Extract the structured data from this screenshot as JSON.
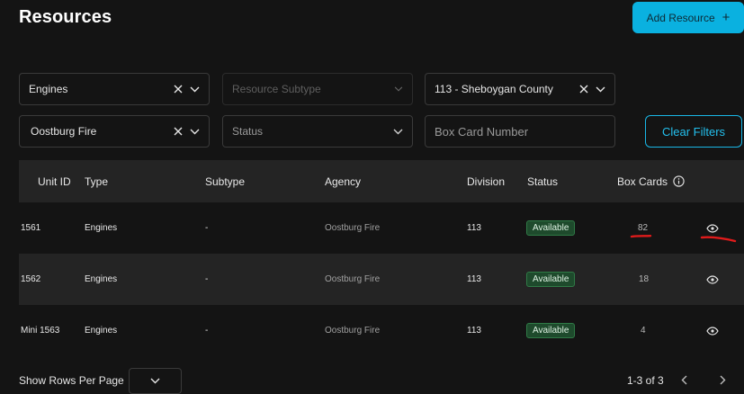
{
  "header": {
    "title": "Resources",
    "add_button_label": "Add Resource"
  },
  "filters": {
    "type": {
      "value": "Engines"
    },
    "subtype": {
      "placeholder": "Resource Subtype"
    },
    "division": {
      "value": "113 - Sheboygan County"
    },
    "agency": {
      "value": "Oostburg Fire"
    },
    "status": {
      "placeholder": "Status"
    },
    "box_card": {
      "placeholder": "Box Card Number"
    },
    "clear_label": "Clear Filters"
  },
  "table": {
    "headers": {
      "unit_id": "Unit ID",
      "type": "Type",
      "subtype": "Subtype",
      "agency": "Agency",
      "division": "Division",
      "status": "Status",
      "box_cards": "Box Cards"
    },
    "rows": [
      {
        "unit_id": "1561",
        "type": "Engines",
        "subtype": "-",
        "agency": "Oostburg Fire",
        "division": "113",
        "status": "Available",
        "box_cards": "82"
      },
      {
        "unit_id": "1562",
        "type": "Engines",
        "subtype": "-",
        "agency": "Oostburg Fire",
        "division": "113",
        "status": "Available",
        "box_cards": "18"
      },
      {
        "unit_id": "Mini 1563",
        "type": "Engines",
        "subtype": "-",
        "agency": "Oostburg Fire",
        "division": "113",
        "status": "Available",
        "box_cards": "4"
      }
    ]
  },
  "footer": {
    "rows_per_page_label": "Show Rows Per Page",
    "pagination_text": "1-3 of 3"
  },
  "colors": {
    "accent": "#0ab1e0",
    "background": "#141414",
    "row_alt": "#242424",
    "status_available": "#1e4a2c",
    "annotation_red": "#e01b1b"
  },
  "icons": [
    "plus-icon",
    "clear-x-icon",
    "chevron-down-icon",
    "info-icon",
    "eye-icon",
    "chevron-left-icon",
    "chevron-right-icon"
  ]
}
